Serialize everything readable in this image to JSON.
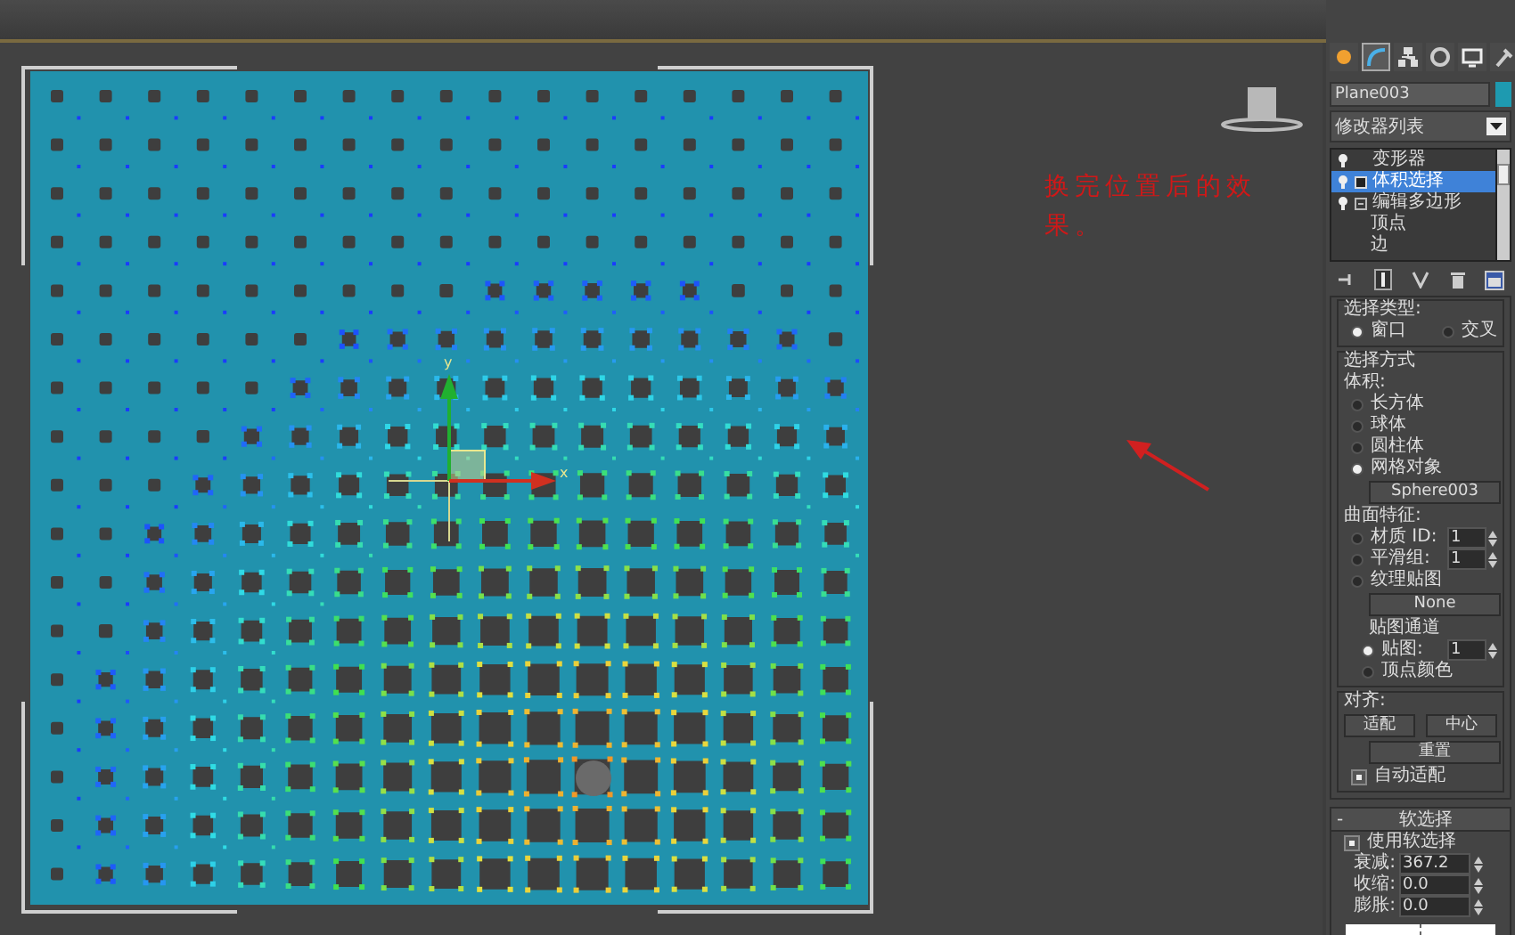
{
  "viewport": {
    "annotation": "换完位置后的效果。",
    "gizmo": {
      "y_label": "y",
      "x_label": "x"
    }
  },
  "panel": {
    "tabs": [
      {
        "kind": "create",
        "selected": false
      },
      {
        "kind": "modify",
        "selected": true
      },
      {
        "kind": "hierarchy",
        "selected": false
      },
      {
        "kind": "motion",
        "selected": false
      },
      {
        "kind": "display",
        "selected": false
      },
      {
        "kind": "utilities",
        "selected": false
      }
    ],
    "object_name": "Plane003",
    "modifier_list": "修改器列表",
    "stack": [
      {
        "label": "变形器",
        "kind": "modifier",
        "selected": false
      },
      {
        "label": "体积选择",
        "kind": "subobject",
        "selected": true
      },
      {
        "label": "编辑多边形",
        "kind": "expandable",
        "selected": false,
        "children": [
          {
            "label": "顶点",
            "selected": false
          },
          {
            "label": "边",
            "selected": false
          }
        ]
      }
    ],
    "volume_select": {
      "selection_type": {
        "title": "选择类型:",
        "options": [
          {
            "label": "窗口",
            "selected": true
          },
          {
            "label": "交叉",
            "selected": false
          }
        ]
      },
      "select_by": {
        "title": "选择方式",
        "volume_title": "体积:",
        "volume_options": [
          {
            "label": "长方体",
            "selected": false
          },
          {
            "label": "球体",
            "selected": false
          },
          {
            "label": "圆柱体",
            "selected": false
          },
          {
            "label": "网格对象",
            "selected": true
          }
        ],
        "mesh_object_button": "Sphere003",
        "surface_title": "曲面特征:",
        "surface_options": [
          {
            "label": "材质 ID:",
            "selected": false,
            "spinner": "1"
          },
          {
            "label": "平滑组:",
            "selected": false,
            "spinner": "1"
          },
          {
            "label": "纹理贴图",
            "selected": false
          }
        ],
        "texture_button": "None",
        "map_channel_title": "贴图通道",
        "map_options": [
          {
            "label": "贴图:",
            "selected": true,
            "spinner": "1"
          },
          {
            "label": "顶点颜色",
            "selected": false
          }
        ]
      },
      "alignment": {
        "title": "对齐:",
        "buttons": [
          "适配",
          "中心",
          "重置"
        ],
        "auto_fit": {
          "label": "自动适配",
          "checked": true
        }
      }
    },
    "soft_selection": {
      "collapse_sign": "-",
      "title": "软选择",
      "use_soft": {
        "label": "使用软选择",
        "checked": true
      },
      "spinners": [
        {
          "label": "衰减:",
          "value": "367.2"
        },
        {
          "label": "收缩:",
          "value": "0.0"
        },
        {
          "label": "膨胀:",
          "value": "0.0"
        }
      ]
    }
  }
}
